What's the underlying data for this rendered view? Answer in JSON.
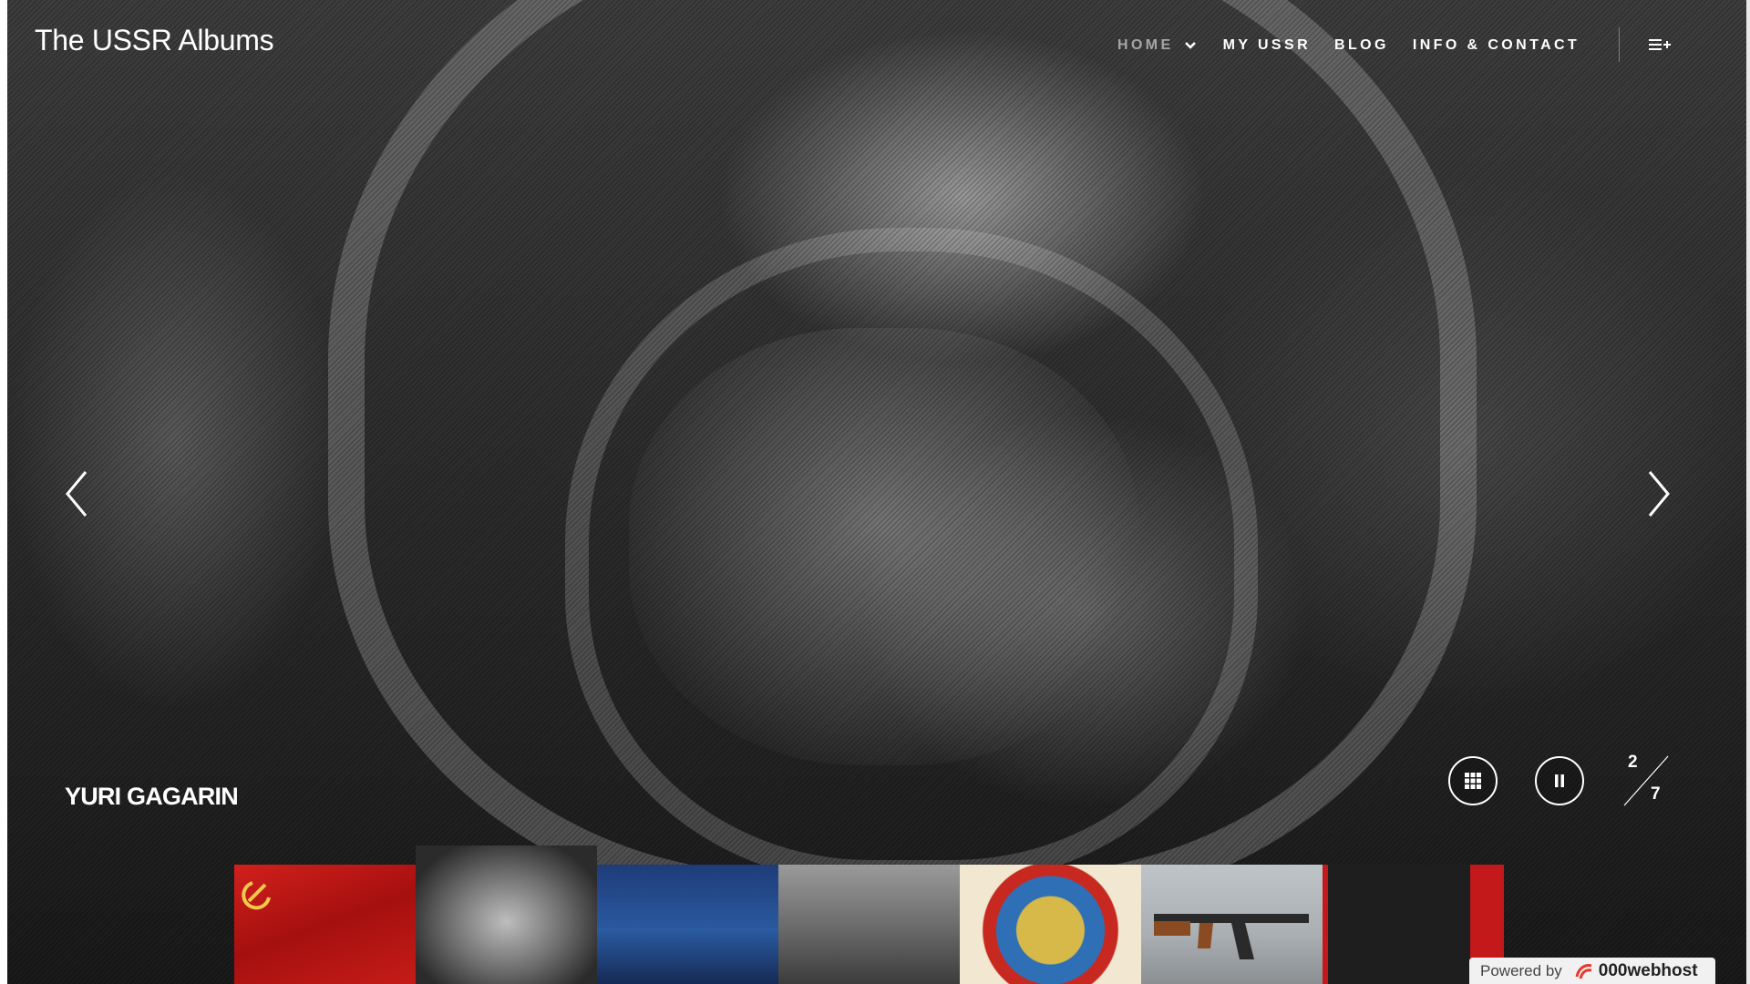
{
  "site": {
    "title": "The USSR Albums"
  },
  "nav": {
    "items": [
      {
        "label": "HOME",
        "active": true
      },
      {
        "label": "MY USSR"
      },
      {
        "label": "BLOG"
      },
      {
        "label": "INFO & CONTACT"
      }
    ],
    "menu_icon": "menu-plus-icon"
  },
  "slide": {
    "caption": "YURI GAGARIN",
    "current": "2",
    "total": "7"
  },
  "controls": {
    "grid_icon": "grid-icon",
    "pause_icon": "pause-icon",
    "prev_icon": "chevron-left-icon",
    "next_icon": "chevron-right-icon"
  },
  "thumbnails": [
    {
      "name": "soviet-flag"
    },
    {
      "name": "gagarin",
      "active": true
    },
    {
      "name": "ballet"
    },
    {
      "name": "war-photo"
    },
    {
      "name": "ussr-emblem"
    },
    {
      "name": "ak-47"
    },
    {
      "name": "stalin-building"
    }
  ],
  "footer": {
    "powered_by": "Powered by",
    "host_name": "000webhost",
    "brand_color": "#e5392e"
  }
}
